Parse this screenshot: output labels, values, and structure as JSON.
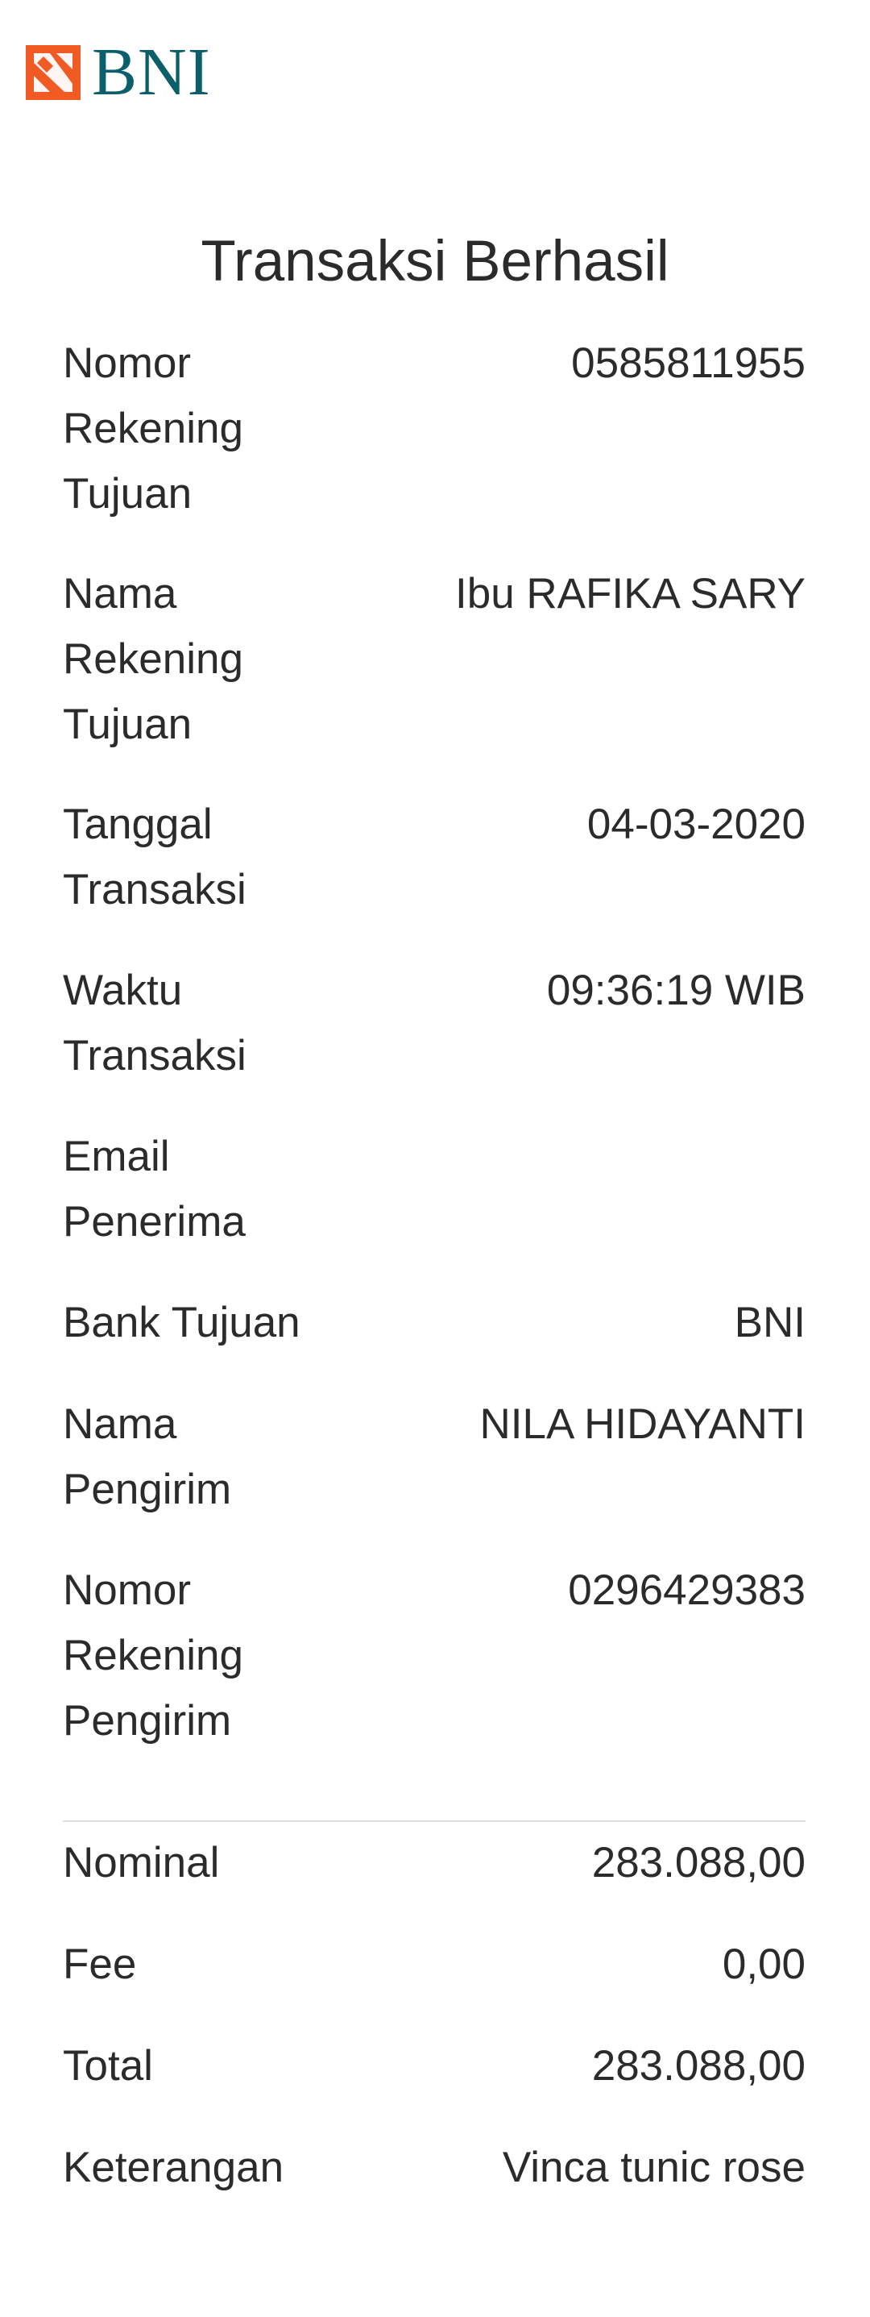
{
  "brand": {
    "name": "BNI",
    "mark_colors": [
      "#f15a22",
      "#ffffff"
    ],
    "text_color": "#0b5f6a"
  },
  "title": "Transaksi Berhasil",
  "details": [
    {
      "label_lines": [
        "Nomor",
        "Rekening",
        "Tujuan"
      ],
      "value": "0585811955"
    },
    {
      "label_lines": [
        "Nama",
        "Rekening",
        "Tujuan"
      ],
      "value": "Ibu RAFIKA SARY"
    },
    {
      "label_lines": [
        "Tanggal",
        "Transaksi"
      ],
      "value": "04-03-2020"
    },
    {
      "label_lines": [
        "Waktu",
        "Transaksi"
      ],
      "value": "09:36:19 WIB"
    },
    {
      "label_lines": [
        "Email",
        "Penerima"
      ],
      "value": ""
    },
    {
      "label_lines": [
        "Bank Tujuan"
      ],
      "value": "BNI"
    },
    {
      "label_lines": [
        "Nama",
        "Pengirim"
      ],
      "value": "NILA HIDAYANTI"
    },
    {
      "label_lines": [
        "Nomor",
        "Rekening",
        "Pengirim"
      ],
      "value": "0296429383"
    }
  ],
  "summary": [
    {
      "label": "Nominal",
      "value": "283.088,00"
    },
    {
      "label": "Fee",
      "value": "0,00"
    },
    {
      "label": "Total",
      "value": "283.088,00"
    },
    {
      "label": "Keterangan",
      "value": "Vinca tunic rose"
    }
  ]
}
